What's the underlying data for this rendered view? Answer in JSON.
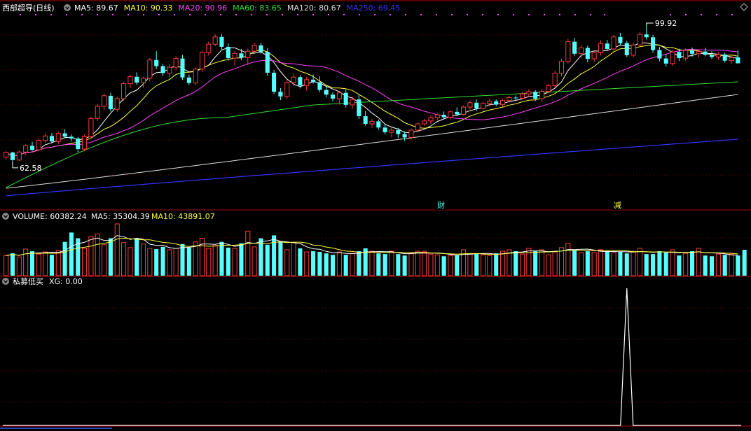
{
  "header": {
    "stock_name": "西部超导(日线)",
    "ma_items": [
      {
        "label": "MA5: 89.67",
        "color": "#ffffff"
      },
      {
        "label": "MA10: 90.33",
        "color": "#ffff3c"
      },
      {
        "label": "MA20: 90.96",
        "color": "#ff44ff"
      },
      {
        "label": "MA60: 83.65",
        "color": "#33dd33"
      },
      {
        "label": "MA120: 80.67",
        "color": "#dddddd"
      },
      {
        "label": "MA250: 69.45",
        "color": "#3333ff"
      }
    ]
  },
  "price_panel": {
    "high_label": "99.92",
    "low_label": "62.58",
    "markers": [
      "财",
      "减"
    ]
  },
  "volume_panel": {
    "title": "VOLUME: 60382.24",
    "ma5": "MA5: 35304.39",
    "ma10": "MA10: 43891.07"
  },
  "indicator_panel": {
    "title": "私募低买",
    "xg": "XG: 0.00"
  },
  "colors": {
    "up": "#ff3c3c",
    "down": "#54ffff",
    "grid": "#7a0000",
    "border": "#b00000",
    "ma5": "#ffffff",
    "ma10": "#ffff3c",
    "ma20": "#ff44ff",
    "ma60": "#33dd33",
    "ma120": "#dddddd",
    "ma250": "#3333ff",
    "marker": "#54ffff",
    "marker_alt": "#ffff3c"
  },
  "chart_data": [
    {
      "type": "candlestick",
      "high": 99.92,
      "low": 62.58,
      "series": [
        {
          "name": "MA5",
          "value": 89.67
        },
        {
          "name": "MA10",
          "value": 90.33
        },
        {
          "name": "MA20",
          "value": 90.96
        },
        {
          "name": "MA60",
          "value": 83.65
        },
        {
          "name": "MA120",
          "value": 80.67
        },
        {
          "name": "MA250",
          "value": 69.45
        }
      ],
      "ohlc": [
        [
          64.0,
          65.6,
          63.3,
          65.3
        ],
        [
          65.3,
          65.5,
          62.6,
          63.2
        ],
        [
          63.2,
          65.8,
          63.0,
          65.4
        ],
        [
          65.4,
          67.5,
          64.6,
          67.1
        ],
        [
          67.1,
          68.2,
          65.6,
          66.0
        ],
        [
          66.0,
          69.0,
          65.7,
          68.6
        ],
        [
          68.6,
          70.5,
          67.9,
          69.8
        ],
        [
          69.8,
          70.6,
          67.8,
          68.3
        ],
        [
          68.3,
          71.0,
          67.6,
          70.5
        ],
        [
          70.5,
          71.7,
          69.2,
          69.6
        ],
        [
          69.6,
          70.2,
          68.3,
          69.1
        ],
        [
          69.1,
          69.5,
          65.4,
          66.2
        ],
        [
          66.2,
          70.2,
          65.6,
          69.6
        ],
        [
          69.6,
          75.1,
          69.1,
          74.6
        ],
        [
          74.6,
          78.6,
          73.9,
          77.9
        ],
        [
          77.9,
          81.4,
          76.8,
          80.8
        ],
        [
          80.8,
          81.6,
          76.5,
          77.1
        ],
        [
          77.1,
          80.6,
          76.4,
          80.0
        ],
        [
          80.0,
          84.6,
          79.4,
          84.1
        ],
        [
          84.1,
          86.6,
          82.9,
          86.0
        ],
        [
          86.0,
          87.2,
          83.8,
          84.4
        ],
        [
          84.4,
          86.0,
          83.0,
          85.6
        ],
        [
          85.6,
          91.1,
          84.7,
          90.6
        ],
        [
          90.6,
          93.0,
          88.1,
          88.9
        ],
        [
          88.9,
          89.6,
          86.2,
          87.0
        ],
        [
          87.0,
          89.4,
          85.8,
          88.6
        ],
        [
          88.6,
          91.6,
          87.9,
          91.0
        ],
        [
          91.0,
          92.0,
          85.1,
          85.8
        ],
        [
          85.8,
          86.6,
          83.7,
          84.3
        ],
        [
          84.3,
          88.6,
          83.6,
          88.1
        ],
        [
          88.1,
          93.2,
          87.4,
          92.6
        ],
        [
          92.6,
          95.6,
          91.8,
          94.9
        ],
        [
          94.9,
          97.6,
          94.4,
          96.9
        ],
        [
          96.9,
          97.7,
          93.5,
          94.2
        ],
        [
          94.2,
          95.1,
          90.4,
          91.1
        ],
        [
          91.1,
          93.0,
          89.1,
          92.4
        ],
        [
          92.4,
          93.6,
          90.5,
          91.2
        ],
        [
          91.2,
          93.7,
          89.2,
          93.0
        ],
        [
          93.0,
          95.3,
          92.6,
          94.6
        ],
        [
          94.6,
          95.3,
          92.3,
          92.8
        ],
        [
          92.8,
          93.9,
          86.3,
          87.1
        ],
        [
          87.1,
          87.8,
          81.3,
          81.9
        ],
        [
          81.9,
          82.9,
          79.6,
          80.6
        ],
        [
          80.6,
          85.2,
          80.0,
          84.4
        ],
        [
          84.4,
          86.9,
          83.5,
          85.9
        ],
        [
          85.9,
          86.5,
          82.8,
          83.6
        ],
        [
          83.6,
          86.0,
          82.2,
          85.2
        ],
        [
          85.2,
          86.6,
          84.1,
          84.5
        ],
        [
          84.5,
          86.1,
          81.8,
          82.4
        ],
        [
          82.4,
          83.4,
          80.4,
          81.1
        ],
        [
          81.1,
          81.8,
          79.2,
          80.0
        ],
        [
          80.0,
          82.1,
          78.4,
          81.6
        ],
        [
          81.6,
          82.5,
          77.6,
          78.3
        ],
        [
          78.3,
          80.6,
          77.2,
          79.8
        ],
        [
          79.8,
          81.0,
          74.4,
          75.2
        ],
        [
          75.2,
          76.6,
          72.6,
          73.1
        ],
        [
          73.1,
          74.5,
          72.0,
          73.8
        ],
        [
          73.8,
          74.3,
          71.5,
          72.1
        ],
        [
          72.1,
          73.0,
          70.2,
          70.8
        ],
        [
          70.8,
          72.0,
          69.4,
          71.4
        ],
        [
          71.4,
          72.0,
          69.3,
          70.3
        ],
        [
          70.3,
          71.0,
          68.4,
          69.4
        ],
        [
          69.4,
          71.8,
          68.8,
          71.4
        ],
        [
          71.4,
          73.6,
          70.9,
          73.1
        ],
        [
          73.1,
          74.5,
          72.6,
          73.9
        ],
        [
          73.9,
          75.4,
          73.1,
          74.8
        ],
        [
          74.8,
          76.0,
          74.1,
          75.6
        ],
        [
          75.6,
          76.5,
          74.3,
          74.9
        ],
        [
          74.9,
          76.8,
          74.2,
          76.4
        ],
        [
          76.4,
          77.6,
          75.2,
          75.7
        ],
        [
          75.7,
          78.1,
          75.4,
          77.7
        ],
        [
          77.7,
          79.5,
          77.0,
          78.9
        ],
        [
          78.9,
          79.8,
          76.6,
          77.3
        ],
        [
          77.3,
          79.2,
          76.7,
          78.7
        ],
        [
          78.7,
          80.0,
          77.9,
          79.3
        ],
        [
          79.3,
          79.8,
          78.0,
          78.4
        ],
        [
          78.4,
          79.9,
          77.8,
          79.5
        ],
        [
          79.5,
          80.8,
          78.9,
          80.3
        ],
        [
          80.3,
          80.9,
          79.6,
          80.1
        ],
        [
          80.1,
          81.8,
          79.8,
          81.3
        ],
        [
          81.3,
          82.6,
          80.6,
          81.9
        ],
        [
          81.9,
          82.3,
          79.4,
          80.0
        ],
        [
          80.0,
          82.6,
          79.1,
          82.0
        ],
        [
          82.0,
          84.1,
          81.4,
          83.6
        ],
        [
          83.6,
          87.6,
          83.0,
          87.0
        ],
        [
          87.0,
          91.0,
          86.1,
          90.2
        ],
        [
          90.2,
          96.3,
          89.6,
          95.6
        ],
        [
          95.6,
          96.6,
          91.6,
          92.3
        ],
        [
          92.3,
          94.6,
          91.2,
          93.9
        ],
        [
          93.9,
          94.5,
          90.0,
          90.9
        ],
        [
          90.9,
          93.0,
          90.1,
          92.6
        ],
        [
          92.6,
          96.0,
          91.8,
          95.1
        ],
        [
          95.1,
          96.1,
          93.0,
          93.6
        ],
        [
          93.6,
          97.5,
          93.1,
          96.9
        ],
        [
          96.9,
          98.0,
          94.6,
          95.2
        ],
        [
          95.2,
          95.8,
          91.4,
          91.9
        ],
        [
          91.9,
          95.4,
          91.3,
          94.7
        ],
        [
          94.7,
          98.3,
          94.0,
          97.6
        ],
        [
          97.6,
          99.92,
          96.2,
          96.8
        ],
        [
          96.8,
          97.5,
          92.6,
          93.3
        ],
        [
          93.3,
          94.2,
          90.2,
          91.0
        ],
        [
          91.0,
          92.2,
          88.8,
          89.6
        ],
        [
          89.6,
          93.4,
          89.0,
          92.8
        ],
        [
          92.8,
          93.7,
          90.3,
          91.1
        ],
        [
          91.1,
          93.8,
          90.4,
          93.2
        ],
        [
          93.2,
          94.0,
          91.5,
          92.3
        ],
        [
          92.3,
          93.6,
          91.2,
          92.9
        ],
        [
          92.9,
          93.9,
          91.6,
          92.0
        ],
        [
          92.0,
          93.0,
          90.9,
          91.4
        ],
        [
          91.4,
          92.8,
          90.6,
          92.1
        ],
        [
          92.1,
          92.6,
          89.9,
          90.4
        ],
        [
          90.4,
          91.9,
          89.6,
          91.3
        ],
        [
          91.3,
          93.2,
          90.8,
          89.67
        ]
      ]
    },
    {
      "type": "bar",
      "title": "VOLUME",
      "series": [
        {
          "name": "VOLUME",
          "value": 60382.24
        },
        {
          "name": "MA5",
          "value": 35304.39
        },
        {
          "name": "MA10",
          "value": 43891.07
        }
      ],
      "values": [
        28000,
        31000,
        26000,
        37000,
        34000,
        30000,
        33000,
        29000,
        35000,
        47000,
        60000,
        52000,
        38000,
        54000,
        58000,
        43000,
        52000,
        72000,
        46000,
        39000,
        52000,
        44000,
        38000,
        37000,
        40000,
        36000,
        38000,
        44000,
        39000,
        47000,
        52000,
        38000,
        42000,
        47000,
        39000,
        38000,
        45000,
        62000,
        40000,
        52000,
        43000,
        56000,
        48000,
        36000,
        46000,
        38000,
        33000,
        34000,
        33000,
        31000,
        29000,
        33000,
        29000,
        31000,
        34000,
        38000,
        34000,
        31000,
        30000,
        34000,
        30000,
        28000,
        31000,
        34000,
        34000,
        30000,
        29000,
        27000,
        28000,
        28000,
        36000,
        30000,
        31000,
        29000,
        28000,
        31000,
        34000,
        36000,
        34000,
        30000,
        38000,
        34000,
        36000,
        29000,
        33000,
        39000,
        45000,
        35000,
        32000,
        34000,
        32000,
        36000,
        34000,
        32000,
        33000,
        31000,
        34000,
        38000,
        30000,
        30000,
        34000,
        32000,
        36000,
        28000,
        31000,
        34000,
        38000,
        28000,
        27000,
        30000,
        29000,
        30000,
        28000,
        36000
      ]
    },
    {
      "type": "line",
      "title": "私募低买",
      "series": [
        {
          "name": "XG",
          "value": 0.0
        }
      ],
      "signal_index": 95,
      "values": "0 except a single spike of 1 at index 95"
    }
  ]
}
